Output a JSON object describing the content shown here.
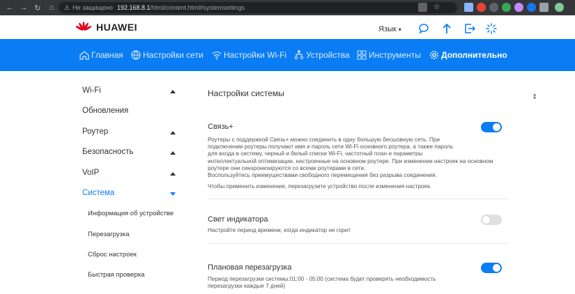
{
  "browser": {
    "security_label": "Не защищено",
    "url_host": "192.168.8.1",
    "url_path": "/html/content.html#systemsettings"
  },
  "header": {
    "brand": "HUAWEI",
    "language_label": "Язык"
  },
  "nav": {
    "items": [
      {
        "label": "Главная",
        "icon": "home-icon"
      },
      {
        "label": "Настройки сети",
        "icon": "globe-icon"
      },
      {
        "label": "Настройки Wi-Fi",
        "icon": "wifi-icon"
      },
      {
        "label": "Устройства",
        "icon": "devices-icon"
      },
      {
        "label": "Инструменты",
        "icon": "tools-icon"
      },
      {
        "label": "Дополнительно",
        "icon": "gear-icon",
        "active": true
      }
    ]
  },
  "sidebar": {
    "items": [
      {
        "label": "Wi-Fi",
        "expanded": false
      },
      {
        "label": "Обновления"
      },
      {
        "label": "Роутер",
        "expanded": false
      },
      {
        "label": "Безопасность",
        "expanded": false
      },
      {
        "label": "VoIP",
        "expanded": false
      },
      {
        "label": "Система",
        "expanded": true,
        "active": true
      }
    ],
    "subitems": [
      {
        "label": "Информация об устройстве"
      },
      {
        "label": "Перезагрузка"
      },
      {
        "label": "Сброс настроек"
      },
      {
        "label": "Быстрая проверка"
      }
    ]
  },
  "main": {
    "page_title": "Настройки системы",
    "sections": [
      {
        "title": "Связь+",
        "enabled": true,
        "lines": [
          "Роутеры с поддержкой Связь+ можно соединить в одну большую бесшовную сеть. При",
          "подключении роутеры получают имя и пароль сети Wi-Fi основного роутера, а также пароль",
          "для входа в систему, черный и белый списки Wi-Fi, частотный план и параметры",
          "интеллектуальной оптимизации, настроенные на основном роутере. При изменении настроек на основном",
          "роутере они синхронизируются со всеми роутерами в сети.",
          "Воспользуйтесь преимуществами свободного перемещения без разрыва соединения."
        ],
        "note": "Чтобы применить изменение, перезагрузите устройство после изменения настроек."
      },
      {
        "title": "Свет индикатора",
        "enabled": false,
        "lines": [
          "Настройте период времени, когда индикатор не горит"
        ]
      },
      {
        "title": "Плановая перезагрузка",
        "enabled": true,
        "lines": [
          "Период перезагрузки системы:01:00 - 05:00 (система будет проверять необходимость",
          "перезагрузки каждые 7 дней)"
        ]
      }
    ]
  },
  "colors": {
    "accent": "#0a7df5",
    "brand_red": "#e1001e"
  }
}
